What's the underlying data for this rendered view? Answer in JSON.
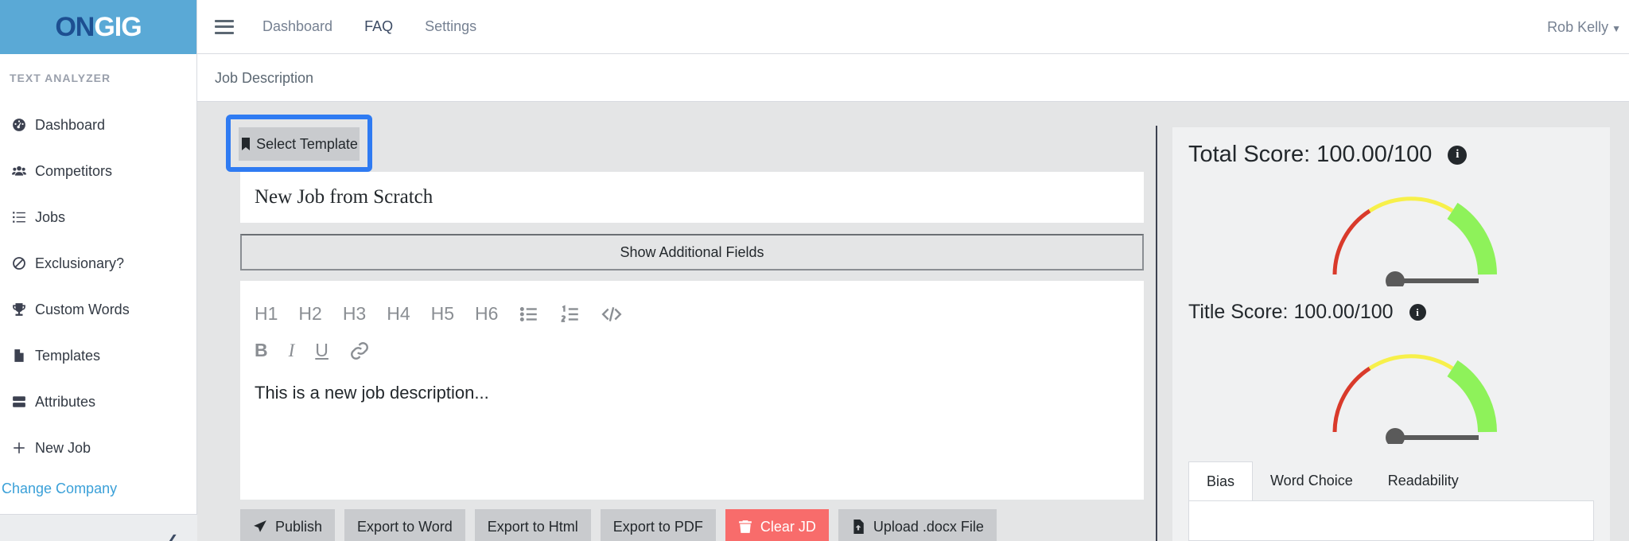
{
  "brand": {
    "part1": "ON",
    "part2": "GIG"
  },
  "header": {
    "links": [
      "Dashboard",
      "FAQ",
      "Settings"
    ],
    "user": "Rob Kelly"
  },
  "sidebar": {
    "section_title": "TEXT ANALYZER",
    "items": [
      {
        "label": "Dashboard",
        "icon": "speedometer-icon"
      },
      {
        "label": "Competitors",
        "icon": "people-icon"
      },
      {
        "label": "Jobs",
        "icon": "list-icon"
      },
      {
        "label": "Exclusionary?",
        "icon": "ban-icon"
      },
      {
        "label": "Custom Words",
        "icon": "trophy-icon"
      },
      {
        "label": "Templates",
        "icon": "file-icon"
      },
      {
        "label": "Attributes",
        "icon": "server-icon"
      },
      {
        "label": "New Job",
        "icon": "plus-icon"
      }
    ],
    "change_company": "Change Company"
  },
  "breadcrumb": "Job Description",
  "editor": {
    "select_template": "Select Template",
    "title_value": "New Job from Scratch",
    "show_fields": "Show Additional Fields",
    "toolbar_headings": [
      "H1",
      "H2",
      "H3",
      "H4",
      "H5",
      "H6"
    ],
    "toolbar_format": {
      "bold": "B",
      "italic": "I",
      "underline": "U"
    },
    "body_text": "This is a new job description..."
  },
  "actions": {
    "publish": "Publish",
    "export_word": "Export to Word",
    "export_html": "Export to Html",
    "export_pdf": "Export to PDF",
    "clear": "Clear JD",
    "upload": "Upload .docx File"
  },
  "scores": {
    "total_label": "Total Score: 100.00/100",
    "total_value": 100,
    "title_label": "Title Score: 100.00/100",
    "title_value": 100,
    "gauge_colors": {
      "low": "#d93a2b",
      "mid": "#f7f04a",
      "high": "#8ef25a",
      "needle": "#5a5a5a"
    }
  },
  "tabs": [
    "Bias",
    "Word Choice",
    "Readability"
  ],
  "colors": {
    "brand_bg": "#5aa9d6",
    "highlight": "#2f7bf2",
    "danger": "#f86c6b",
    "link": "#3aa0d8"
  }
}
